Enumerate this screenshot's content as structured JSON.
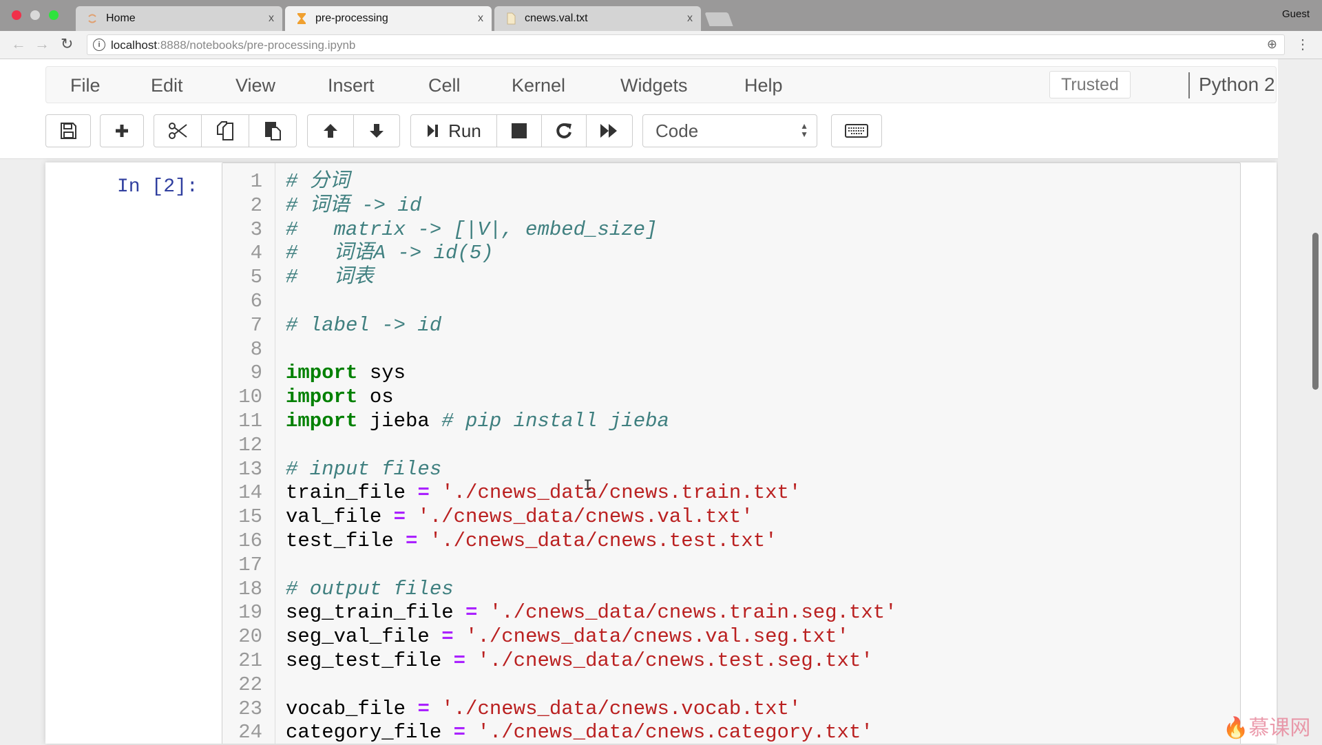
{
  "browser": {
    "tabs": [
      {
        "label": "Home",
        "icon": "jupyter-loading-icon",
        "active": false
      },
      {
        "label": "pre-processing",
        "icon": "hourglass-icon",
        "active": true
      },
      {
        "label": "cnews.val.txt",
        "icon": "file-icon",
        "active": false
      }
    ],
    "tab_close_glyph": "x",
    "profile": "Guest",
    "url_host": "localhost",
    "url_rest": ":8888/notebooks/pre-processing.ipynb"
  },
  "menubar": {
    "items": [
      "File",
      "Edit",
      "View",
      "Insert",
      "Cell",
      "Kernel",
      "Widgets",
      "Help"
    ],
    "trusted": "Trusted",
    "kernel": "Python 2"
  },
  "toolbar": {
    "run_label": "Run",
    "cell_type": "Code"
  },
  "cell": {
    "prompt": "In [2]:",
    "lines": [
      [
        {
          "t": "c",
          "s": "# 分词"
        }
      ],
      [
        {
          "t": "c",
          "s": "# 词语 -> id"
        }
      ],
      [
        {
          "t": "c",
          "s": "#   matrix -> [|V|, embed_size]"
        }
      ],
      [
        {
          "t": "c",
          "s": "#   词语A -> id(5)"
        }
      ],
      [
        {
          "t": "c",
          "s": "#   词表"
        }
      ],
      [],
      [
        {
          "t": "c",
          "s": "# label -> id"
        }
      ],
      [],
      [
        {
          "t": "k",
          "s": "import"
        },
        {
          "t": "v",
          "s": " sys"
        }
      ],
      [
        {
          "t": "k",
          "s": "import"
        },
        {
          "t": "v",
          "s": " os"
        }
      ],
      [
        {
          "t": "k",
          "s": "import"
        },
        {
          "t": "v",
          "s": " jieba "
        },
        {
          "t": "c",
          "s": "# pip install jieba"
        }
      ],
      [],
      [
        {
          "t": "c",
          "s": "# input files"
        }
      ],
      [
        {
          "t": "v",
          "s": "train_file "
        },
        {
          "t": "o",
          "s": "="
        },
        {
          "t": "s",
          "s": " './cnews_data/cnews.train.txt'"
        }
      ],
      [
        {
          "t": "v",
          "s": "val_file "
        },
        {
          "t": "o",
          "s": "="
        },
        {
          "t": "s",
          "s": " './cnews_data/cnews.val.txt'"
        }
      ],
      [
        {
          "t": "v",
          "s": "test_file "
        },
        {
          "t": "o",
          "s": "="
        },
        {
          "t": "s",
          "s": " './cnews_data/cnews.test.txt'"
        }
      ],
      [],
      [
        {
          "t": "c",
          "s": "# output files"
        }
      ],
      [
        {
          "t": "v",
          "s": "seg_train_file "
        },
        {
          "t": "o",
          "s": "="
        },
        {
          "t": "s",
          "s": " './cnews_data/cnews.train.seg.txt'"
        }
      ],
      [
        {
          "t": "v",
          "s": "seg_val_file "
        },
        {
          "t": "o",
          "s": "="
        },
        {
          "t": "s",
          "s": " './cnews_data/cnews.val.seg.txt'"
        }
      ],
      [
        {
          "t": "v",
          "s": "seg_test_file "
        },
        {
          "t": "o",
          "s": "="
        },
        {
          "t": "s",
          "s": " './cnews_data/cnews.test.seg.txt'"
        }
      ],
      [],
      [
        {
          "t": "v",
          "s": "vocab_file "
        },
        {
          "t": "o",
          "s": "="
        },
        {
          "t": "s",
          "s": " './cnews_data/cnews.vocab.txt'"
        }
      ],
      [
        {
          "t": "v",
          "s": "category_file "
        },
        {
          "t": "o",
          "s": "="
        },
        {
          "t": "s",
          "s": " './cnews_data/cnews.category.txt'"
        }
      ]
    ]
  },
  "colors": {
    "comment": "#408080",
    "keyword": "#008000",
    "operator": "#aa22ff",
    "string": "#ba2121",
    "prompt": "#303f9f"
  },
  "watermark": "慕课网"
}
